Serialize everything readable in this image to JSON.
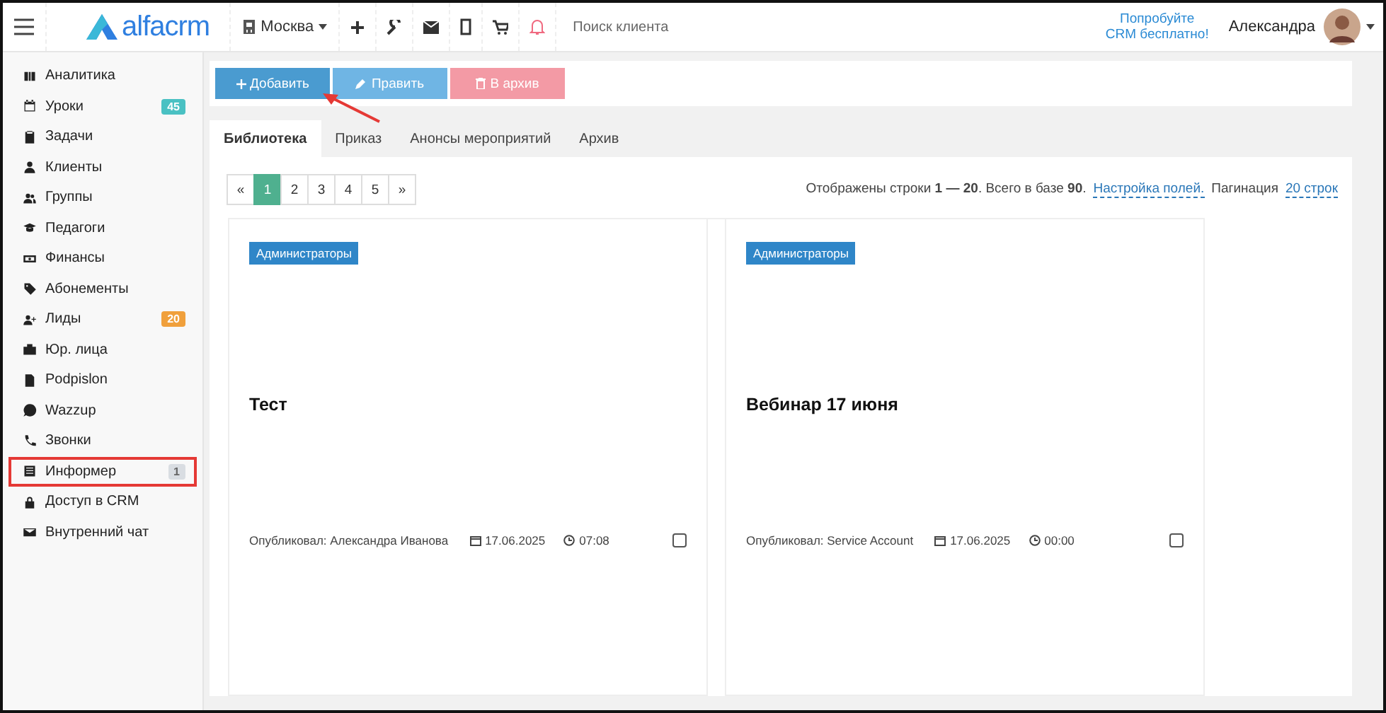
{
  "topbar": {
    "logo": "alfacrm",
    "branch": "Москва",
    "search": {
      "placeholder": "Поиск клиента"
    },
    "promo": [
      "Попробуйте",
      "CRM бесплатно!"
    ],
    "user": "Александра"
  },
  "sidebar": {
    "items": [
      {
        "label": "Аналитика",
        "highlighted": false
      },
      {
        "label": "Уроки",
        "badge": "45",
        "color": "#4ac1c3",
        "highlighted": false
      },
      {
        "label": "Задачи",
        "highlighted": false
      },
      {
        "label": "Клиенты",
        "highlighted": false
      },
      {
        "label": "Группы",
        "highlighted": false
      },
      {
        "label": "Педагоги",
        "highlighted": false
      },
      {
        "label": "Финансы",
        "highlighted": false
      },
      {
        "label": "Абонементы",
        "highlighted": false
      },
      {
        "label": "Лиды",
        "badge": "20",
        "color": "#f0a03c",
        "highlighted": false
      },
      {
        "label": "Юр. лица",
        "highlighted": false
      },
      {
        "label": "Podpislon",
        "highlighted": false
      },
      {
        "label": "Wazzup",
        "highlighted": false
      },
      {
        "label": "Звонки",
        "highlighted": false
      },
      {
        "label": "Информер",
        "badge": "1",
        "color": "#d9dde2",
        "highlighted": true
      },
      {
        "label": "Доступ в CRM",
        "highlighted": false
      },
      {
        "label": "Внутренний чат",
        "highlighted": false
      }
    ]
  },
  "actions": [
    {
      "label": "Добавить",
      "kind": "add"
    },
    {
      "label": "Править",
      "kind": "edit"
    },
    {
      "label": "В архив",
      "kind": "archive"
    }
  ],
  "tabs": [
    {
      "label": "Библиотека",
      "selected": true
    },
    {
      "label": "Приказ",
      "selected": false
    },
    {
      "label": "Анонсы мероприятий",
      "selected": false
    },
    {
      "label": "Архив",
      "selected": false
    }
  ],
  "pagination": {
    "pages": [
      {
        "label": "«",
        "selected": false
      },
      {
        "label": "1",
        "selected": true
      },
      {
        "label": "2",
        "selected": false
      },
      {
        "label": "3",
        "selected": false
      },
      {
        "label": "4",
        "selected": false
      },
      {
        "label": "5",
        "selected": false
      },
      {
        "label": "»",
        "selected": false
      }
    ],
    "info": "Отображены строки **1 — 20**. Всего в базе **90**.",
    "fields_link": "Настройка полей.",
    "pagination_label": "Пагинация",
    "rows_link": "20 строк"
  },
  "cards": [
    {
      "tag": "Администраторы",
      "title": "Тест",
      "author": "Опубликовал: Александра Иванова",
      "date": "17.06.2025",
      "time": "07:08",
      "checked": false
    },
    {
      "tag": "Администраторы",
      "title": "Вебинар 17 июня",
      "author": "Опубликовал: Service Account",
      "date": "17.06.2025",
      "time": "00:00",
      "checked": false
    }
  ]
}
